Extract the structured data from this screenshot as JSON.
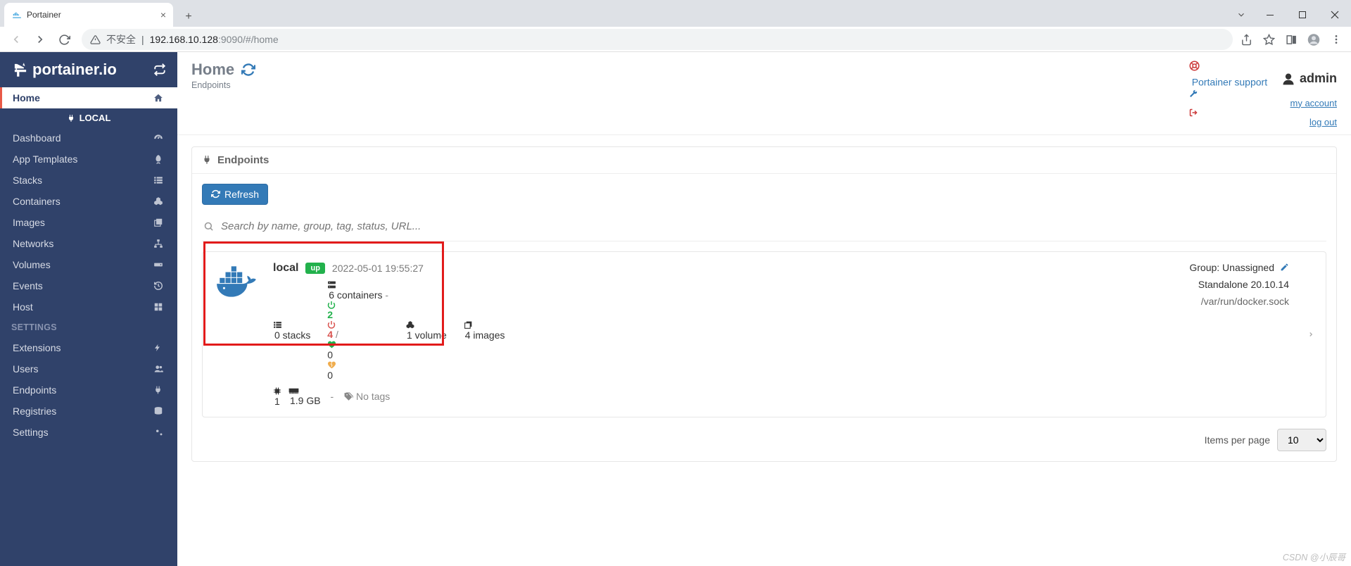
{
  "browser": {
    "tab_title": "Portainer",
    "insecure_label": "不安全",
    "url_host": "192.168.10.128",
    "url_port": ":9090",
    "url_path": "/#/home"
  },
  "header": {
    "title": "Home",
    "subtitle": "Endpoints",
    "support": "Portainer support",
    "user": "admin",
    "my_account": "my account",
    "logout": "log out"
  },
  "sidebar": {
    "brand": "portainer.io",
    "env_label": "LOCAL",
    "items": [
      {
        "label": "Home",
        "icon": "home",
        "active": true
      },
      {
        "label": "Dashboard",
        "icon": "gauge"
      },
      {
        "label": "App Templates",
        "icon": "rocket"
      },
      {
        "label": "Stacks",
        "icon": "list"
      },
      {
        "label": "Containers",
        "icon": "cubes"
      },
      {
        "label": "Images",
        "icon": "clone"
      },
      {
        "label": "Networks",
        "icon": "sitemap"
      },
      {
        "label": "Volumes",
        "icon": "hdd"
      },
      {
        "label": "Events",
        "icon": "history"
      },
      {
        "label": "Host",
        "icon": "grid"
      }
    ],
    "settings_header": "SETTINGS",
    "settings": [
      {
        "label": "Extensions",
        "icon": "bolt"
      },
      {
        "label": "Users",
        "icon": "users"
      },
      {
        "label": "Endpoints",
        "icon": "plug"
      },
      {
        "label": "Registries",
        "icon": "database"
      },
      {
        "label": "Settings",
        "icon": "cogs"
      }
    ]
  },
  "panel": {
    "title": "Endpoints",
    "refresh": "Refresh",
    "search_placeholder": "Search by name, group, tag, status, URL...",
    "items_per_page": "Items per page",
    "page_size": "10"
  },
  "endpoint": {
    "name": "local",
    "status": "up",
    "timestamp": "2022-05-01 19:55:27",
    "stacks": "0 stacks",
    "containers_label": "6 containers",
    "running": "2",
    "stopped": "4",
    "healthy": "0",
    "unhealthy": "0",
    "volumes": "1 volume",
    "images": "4 images",
    "cpus": "1",
    "memory": "1.9 GB",
    "tags": "No tags",
    "group": "Group: Unassigned",
    "engine": "Standalone 20.10.14",
    "socket": "/var/run/docker.sock"
  },
  "watermark": "CSDN @小辰哥"
}
